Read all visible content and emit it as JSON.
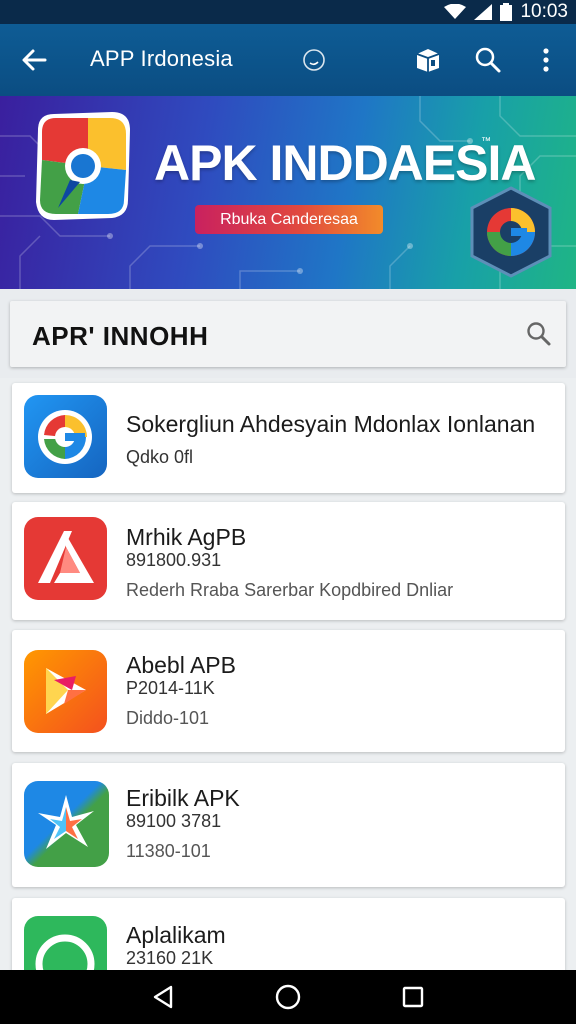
{
  "status_bar": {
    "time": "10:03"
  },
  "app_bar": {
    "title": "APP Irdonesia",
    "icons": [
      "back-arrow-icon",
      "search-circle-icon",
      "box-icon",
      "search-icon",
      "more-vert-icon"
    ]
  },
  "banner": {
    "headline": "APK INDDAESIA",
    "tm": "™",
    "pill_text": "Rbuka Canderesaa"
  },
  "section": {
    "title": "APR' INNOHH"
  },
  "apps": [
    {
      "name": "Sokergliun Ahdesyain Mdonlax Ionlanan",
      "sub": "Qdko 0fl",
      "desc": "",
      "icon": "g-blue-icon"
    },
    {
      "name": "Mrhik AgPB",
      "sub": "891800.931",
      "desc": "Rederh Rraba Sarerbar Kopdbired Dnliar",
      "icon": "a-red-icon"
    },
    {
      "name": "Abebl APB",
      "sub": "P2014-11K",
      "desc": "Diddo-101",
      "icon": "play-orange-icon"
    },
    {
      "name": "Eribilk APK",
      "sub": "89100 3781",
      "desc": "11380-101",
      "icon": "star-blue-green-icon"
    },
    {
      "name": "Aplalikam",
      "sub": "23160 21K",
      "desc": "",
      "icon": "circle-green-icon"
    }
  ],
  "nav": {
    "icons": [
      "back-triangle-icon",
      "home-circle-icon",
      "recents-square-icon"
    ]
  },
  "colors": {
    "app_bar": "#0b4d82",
    "status_bar": "#0a2a4a",
    "accent": "#e0483f"
  }
}
